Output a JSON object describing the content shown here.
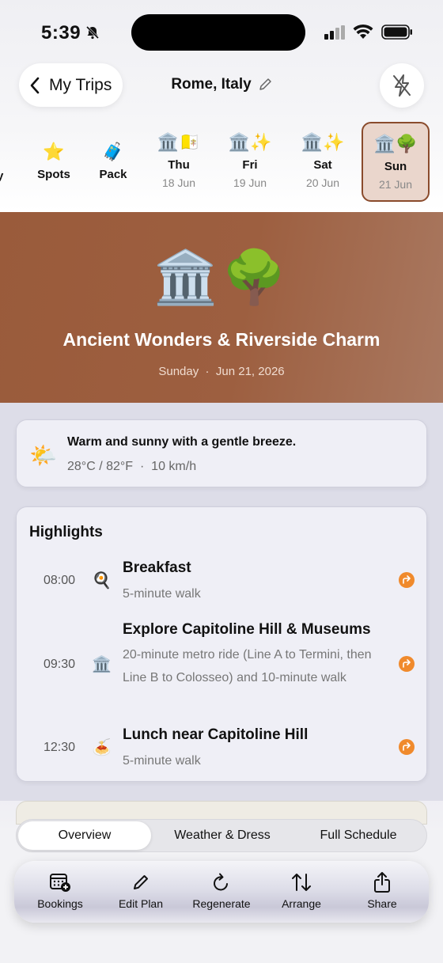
{
  "status": {
    "time": "5:39"
  },
  "header": {
    "back_label": "My Trips",
    "trip_title": "Rome, Italy"
  },
  "days": {
    "partial_label": "y",
    "spots": {
      "icon": "⭐",
      "label": "Spots"
    },
    "pack": {
      "icon": "🧳",
      "label": "Pack"
    },
    "items": [
      {
        "icons": "🏛️🇻🇦",
        "day": "Thu",
        "date": "18 Jun"
      },
      {
        "icons": "🏛️✨",
        "day": "Fri",
        "date": "19 Jun"
      },
      {
        "icons": "🏛️✨",
        "day": "Sat",
        "date": "20 Jun"
      },
      {
        "icons": "🏛️🌳",
        "day": "Sun",
        "date": "21 Jun"
      }
    ]
  },
  "hero": {
    "emojis": "🏛️🌳",
    "title": "Ancient Wonders & Riverside Charm",
    "weekday": "Sunday",
    "date": "Jun 21, 2026"
  },
  "weather": {
    "icon": "🌤️",
    "description": "Warm and sunny with a gentle breeze.",
    "temperature": "28°C / 82°F",
    "wind": "10 km/h"
  },
  "highlights": {
    "title": "Highlights",
    "items": [
      {
        "time": "08:00",
        "icon": "🍳",
        "title": "Breakfast",
        "desc": "5-minute walk"
      },
      {
        "time": "09:30",
        "icon": "🏛️",
        "title": "Explore Capitoline Hill & Museums",
        "desc": "20-minute metro ride (Line A to Termini, then Line B to Colosseo) and 10-minute walk"
      },
      {
        "time": "12:30",
        "icon": "🍝",
        "title": "Lunch near Capitoline Hill",
        "desc": "5-minute walk"
      }
    ]
  },
  "segments": [
    "Overview",
    "Weather & Dress",
    "Full Schedule"
  ],
  "toolbar": [
    "Bookings",
    "Edit Plan",
    "Regenerate",
    "Arrange",
    "Share"
  ],
  "colors": {
    "accent": "#f08a2c",
    "hero": "#9d5f40",
    "selected_tab_border": "#8a4b2c"
  }
}
